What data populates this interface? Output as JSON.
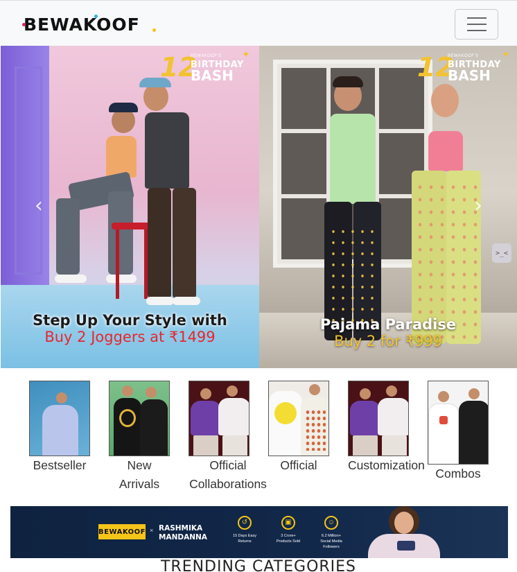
{
  "header": {
    "logo_text": "BEWAKOOF",
    "menu_icon": "hamburger-menu-icon"
  },
  "carousel": {
    "slides": [
      {
        "badge_number": "12",
        "badge_small": "BEWAKOOF'S",
        "badge_line1": "BIRTHDAY",
        "badge_line2": "BASH",
        "caption_line1": "Step Up Your Style with",
        "caption_line2": "Buy 2 Joggers at ₹1499"
      },
      {
        "badge_number": "12",
        "badge_small": "BEWAKOOF'S",
        "badge_line1": "BIRTHDAY",
        "badge_line2": "BASH",
        "caption_line1": "Pajama Paradise",
        "caption_line2": "Buy 2 for ₹999"
      }
    ],
    "prev_icon": "chevron-left-icon",
    "next_icon": "chevron-right-icon",
    "prev_glyph": "‹",
    "next_glyph": "›",
    "widget_glyph": ">_<"
  },
  "categories": [
    {
      "label": "Bestseller"
    },
    {
      "label": "New Arrivals"
    },
    {
      "label": "Official Collaborations"
    },
    {
      "label": "Official"
    },
    {
      "label": "Customization"
    },
    {
      "label": "Combos"
    }
  ],
  "banner": {
    "brand": "BEWAKOOF",
    "x": "×",
    "name_line1": "RASHMIKA",
    "name_line2": "MANDANNA",
    "stats": [
      {
        "icon": "return-icon",
        "glyph": "↺",
        "line1": "15 Days Easy",
        "line2": "Returns"
      },
      {
        "icon": "box-icon",
        "glyph": "▣",
        "line1": "3 Crore+",
        "line2": "Products Sold"
      },
      {
        "icon": "followers-icon",
        "glyph": "☺",
        "line1": "6.2 Million+",
        "line2": "Social Media Followers"
      }
    ]
  },
  "section_title": "TRENDING CATEGORIES"
}
